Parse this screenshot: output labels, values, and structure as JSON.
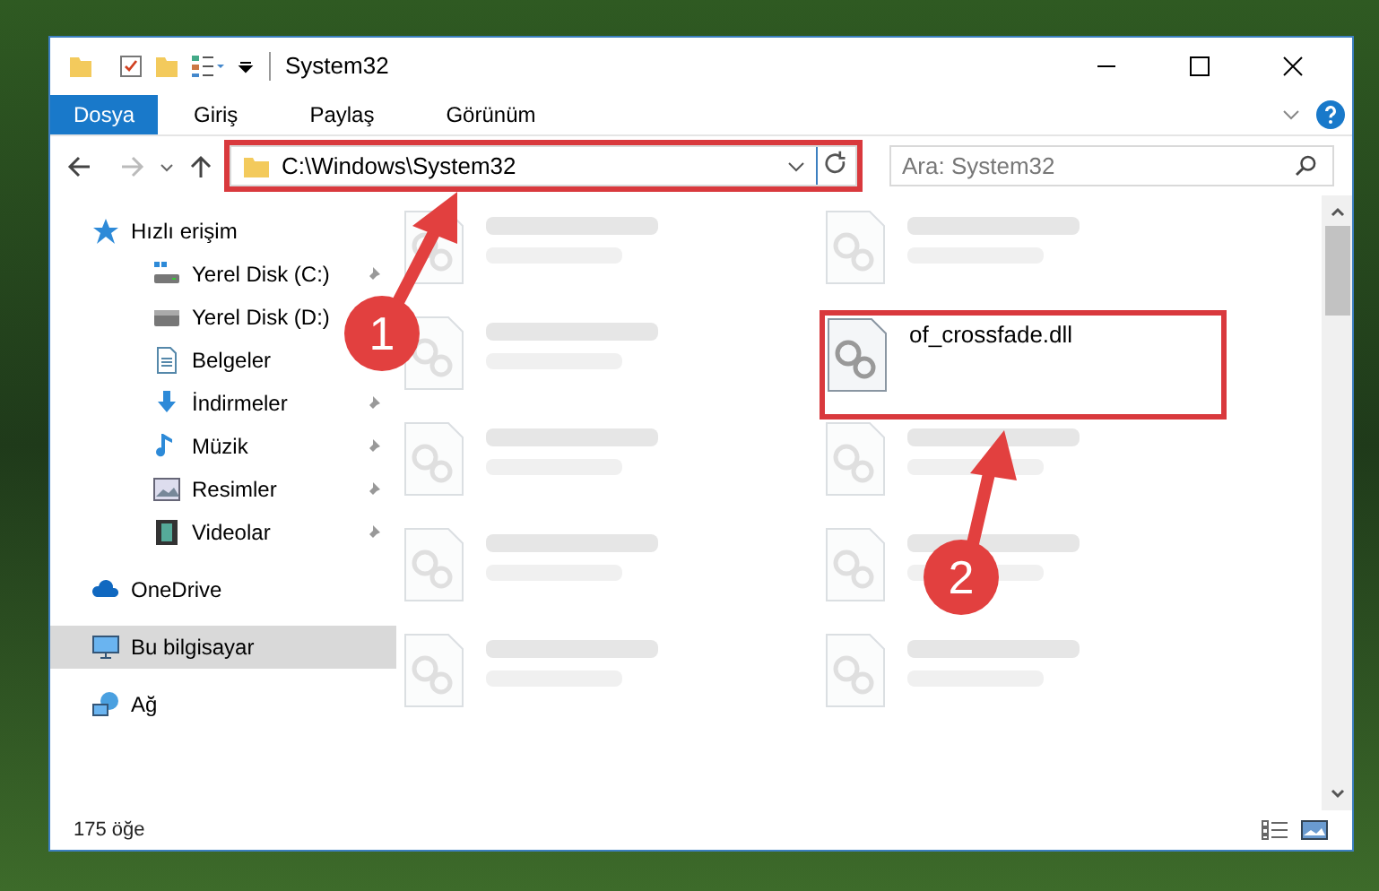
{
  "window": {
    "title": "System32"
  },
  "ribbon_tabs": [
    {
      "label": "Dosya",
      "selected": true
    },
    {
      "label": "Giriş",
      "selected": false
    },
    {
      "label": "Paylaş",
      "selected": false
    },
    {
      "label": "Görünüm",
      "selected": false
    }
  ],
  "address": {
    "path": "C:\\Windows\\System32",
    "highlighted": true
  },
  "search": {
    "placeholder": "Ara: System32"
  },
  "nav": [
    {
      "label": "Hızlı erişim",
      "kind": "star",
      "selected": false,
      "children": [
        {
          "label": "Yerel Disk (C:)",
          "kind": "drive-win",
          "pinned": true
        },
        {
          "label": "Yerel Disk (D:)",
          "kind": "drive"
        },
        {
          "label": "Belgeler",
          "kind": "document"
        },
        {
          "label": "İndirmeler",
          "kind": "download",
          "pinned": true
        },
        {
          "label": "Müzik",
          "kind": "music",
          "pinned": true
        },
        {
          "label": "Resimler",
          "kind": "picture",
          "pinned": true
        },
        {
          "label": "Videolar",
          "kind": "video",
          "pinned": true
        }
      ]
    },
    {
      "label": "OneDrive",
      "kind": "cloud",
      "selected": false
    },
    {
      "label": "Bu bilgisayar",
      "kind": "pc",
      "selected": true
    },
    {
      "label": "Ağ",
      "kind": "network",
      "selected": false
    }
  ],
  "files": [
    {
      "blurred": true
    },
    {
      "blurred": true
    },
    {
      "blurred": true
    },
    {
      "name": "of_crossfade.dll",
      "blurred": false,
      "highlighted": true
    },
    {
      "blurred": true
    },
    {
      "blurred": true
    },
    {
      "blurred": true
    },
    {
      "blurred": true
    },
    {
      "blurred": true
    },
    {
      "blurred": true
    }
  ],
  "status_bar": {
    "count": "175 öğe"
  },
  "annotations": [
    {
      "number": "1"
    },
    {
      "number": "2"
    }
  ]
}
